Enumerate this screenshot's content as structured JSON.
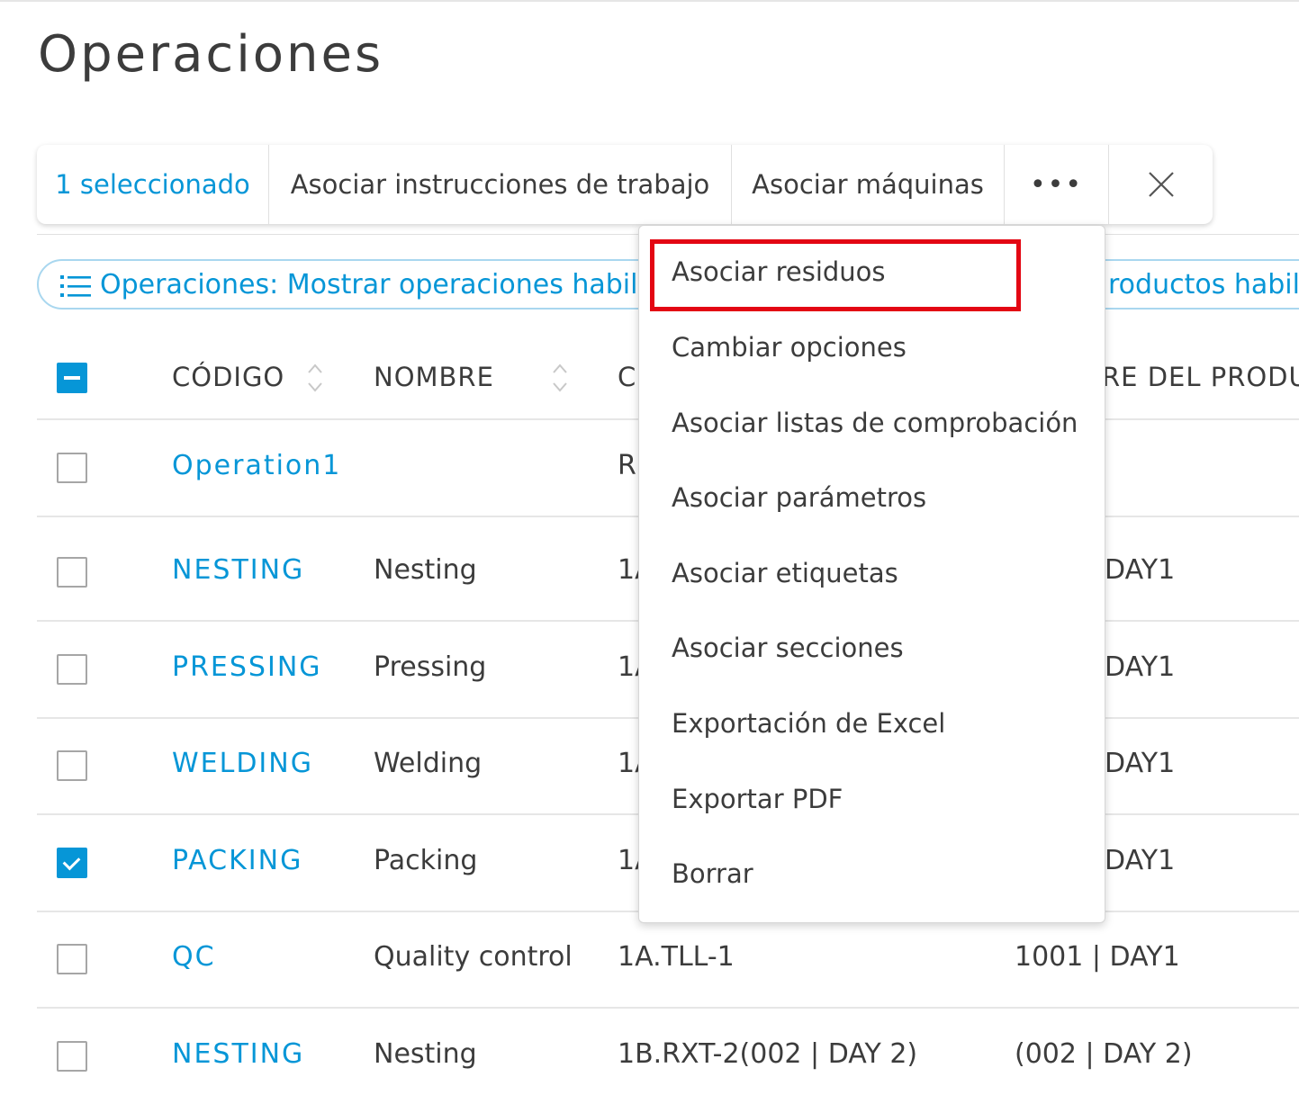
{
  "page": {
    "title": "Operaciones"
  },
  "action_bar": {
    "selected": "1 seleccionado",
    "associate_instructions": "Asociar instrucciones de trabajo",
    "associate_machines": "Asociar máquinas",
    "more": "•••"
  },
  "filters": {
    "operations": "Operaciones: Mostrar operaciones habilit",
    "products": "roductos habilit"
  },
  "table": {
    "headers": {
      "code": "CÓDIGO",
      "name": "NOMBRE",
      "center": "C",
      "product": "RE DEL PRODUC"
    },
    "rows": [
      {
        "code": "Operation1",
        "name": "",
        "center": "R",
        "product": "",
        "checked": false
      },
      {
        "code": "NESTING",
        "name": "Nesting",
        "center": "1A",
        "product": "DAY1",
        "checked": false
      },
      {
        "code": "PRESSING",
        "name": "Pressing",
        "center": "1A",
        "product": "DAY1",
        "checked": false
      },
      {
        "code": "WELDING",
        "name": "Welding",
        "center": "1A",
        "product": "DAY1",
        "checked": false
      },
      {
        "code": "PACKING",
        "name": "Packing",
        "center": "1A",
        "product": "DAY1",
        "checked": true
      },
      {
        "code": "QC",
        "name": "Quality control",
        "center": "1A.TLL-1",
        "product": "1001 | DAY1",
        "checked": false
      },
      {
        "code": "NESTING",
        "name": "Nesting",
        "center": "1B.RXT-2(002 | DAY 2)",
        "product": "(002 | DAY 2)",
        "checked": false
      }
    ]
  },
  "menu": {
    "items": [
      "Asociar residuos",
      "Cambiar opciones",
      "Asociar listas de comprobación",
      "Asociar parámetros",
      "Asociar etiquetas",
      "Asociar secciones",
      "Exportación de Excel",
      "Exportar PDF",
      "Borrar"
    ],
    "highlighted": "Asociar residuos"
  },
  "colors": {
    "accent": "#0696d7",
    "highlight": "#e30613",
    "text": "#3c3c3c"
  }
}
